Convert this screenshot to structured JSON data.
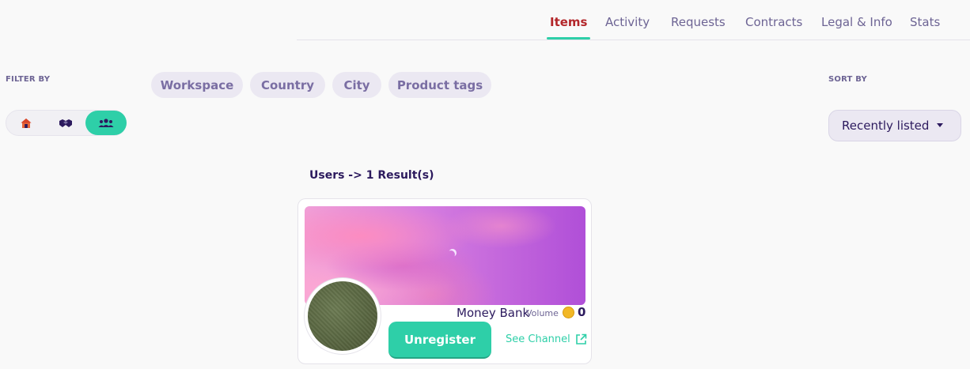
{
  "topnav": {
    "tabs": [
      {
        "label": "Items",
        "active": true
      },
      {
        "label": "Activity",
        "active": false
      },
      {
        "label": "Requests",
        "active": false
      },
      {
        "label": "Contracts",
        "active": false
      },
      {
        "label": "Legal & Info",
        "active": false
      },
      {
        "label": "Stats",
        "active": false
      }
    ]
  },
  "filter": {
    "label": "FILTER BY",
    "chips": [
      "Workspace",
      "Country",
      "City",
      "Product tags"
    ],
    "segments": [
      {
        "icon": "home-icon",
        "active": false
      },
      {
        "icon": "handshake-icon",
        "active": false
      },
      {
        "icon": "users-icon",
        "active": true
      }
    ]
  },
  "sort": {
    "label": "SORT BY",
    "selected": "Recently listed"
  },
  "results": {
    "title": "Users -> 1 Result(s)"
  },
  "card": {
    "name": "Money Bank",
    "volume_label": "Volume",
    "volume_value": "0",
    "unregister_label": "Unregister",
    "see_channel_label": "See Channel"
  },
  "colors": {
    "accent": "#2ecfa8",
    "active_tab": "#b3262a",
    "text_primary": "#2c1a5e",
    "chip_bg": "#ebe8f2"
  }
}
